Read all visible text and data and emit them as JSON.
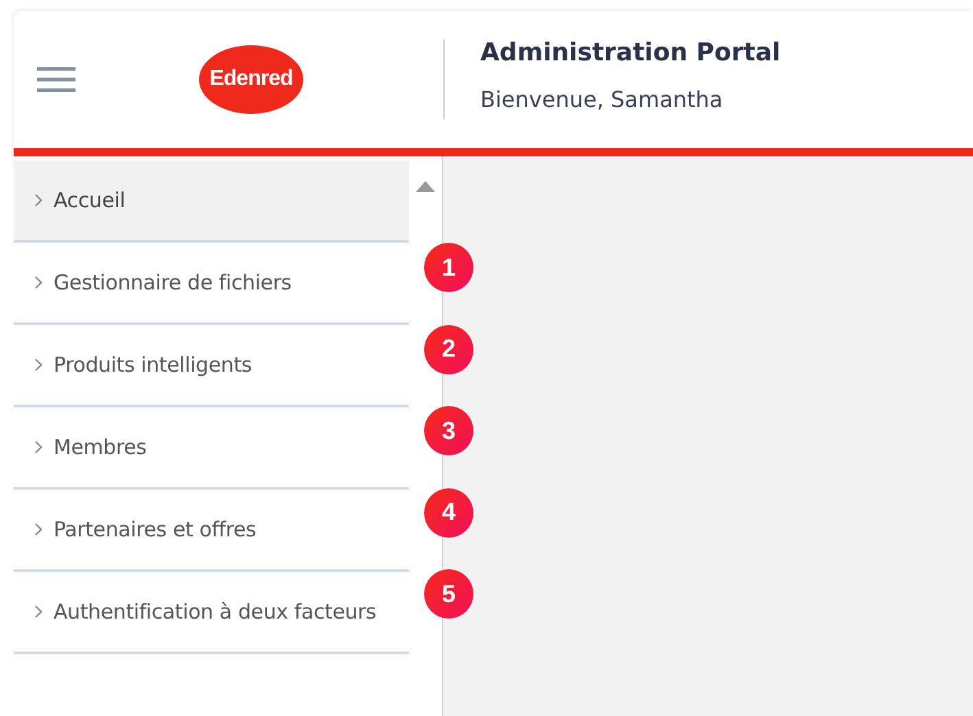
{
  "header": {
    "logo": "Edenred",
    "title": "Administration Portal",
    "subtitle": "Bienvenue, Samantha"
  },
  "sidebar": {
    "items": [
      {
        "label": "Accueil",
        "selected": true
      },
      {
        "label": "Gestionnaire de fichiers",
        "selected": false,
        "badge": "1"
      },
      {
        "label": "Produits intelligents",
        "selected": false,
        "badge": "2"
      },
      {
        "label": "Membres",
        "selected": false,
        "badge": "3"
      },
      {
        "label": "Partenaires et offres",
        "selected": false,
        "badge": "4"
      },
      {
        "label": "Authentification à deux facteurs",
        "selected": false,
        "badge": "5"
      }
    ]
  }
}
